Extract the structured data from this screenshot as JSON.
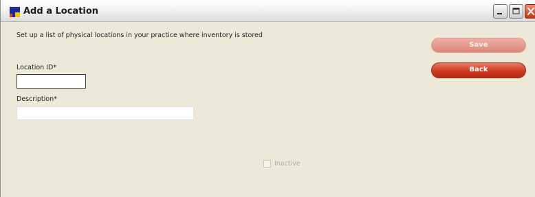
{
  "window": {
    "title": "Add a Location",
    "colors": {
      "app_icon_blue": "#1c2b9a",
      "app_icon_yellow": "#f2c700",
      "app_icon_red": "#e04020",
      "close_button": "#c13818"
    }
  },
  "form": {
    "instructions": "Set up a list of physical locations in your practice where inventory is stored",
    "location_id": {
      "label": "Location ID*",
      "value": "",
      "placeholder": ""
    },
    "description": {
      "label": "Description*",
      "value": "",
      "placeholder": ""
    },
    "inactive": {
      "label": "Inactive",
      "checked": false,
      "disabled": true
    }
  },
  "actions": {
    "save_label": "Save",
    "back_label": "Back",
    "save_disabled": true,
    "accent": "#cf3a20"
  },
  "icons": {
    "app": "app-logo-icon",
    "minimize": "minimize-icon",
    "maximize": "maximize-icon",
    "close": "close-icon"
  }
}
